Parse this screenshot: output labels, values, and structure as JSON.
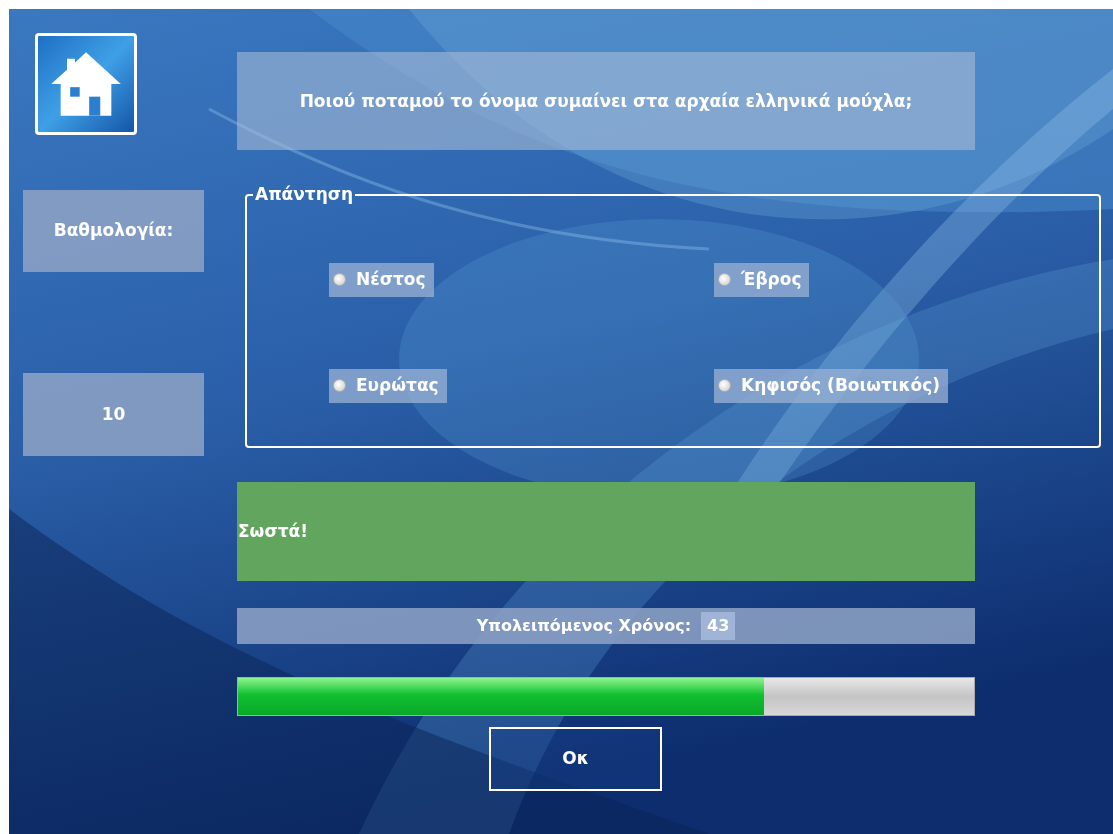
{
  "question": "Ποιού ποταμού το όνομα συμαίνει στα αρχαία ελληνικά μούχλα;",
  "score": {
    "label": "Βαθμολογία:",
    "value": "10"
  },
  "answer": {
    "legend": "Απάντηση",
    "options": [
      {
        "label": "Νέστος",
        "selected": false
      },
      {
        "label": "Έβρος",
        "selected": false
      },
      {
        "label": "Ευρώτας",
        "selected": false
      },
      {
        "label": "Κηφισός (Βοιωτικός)",
        "selected": false
      }
    ]
  },
  "feedback": {
    "text": "Σωστά!",
    "kind": "correct"
  },
  "timer": {
    "label": "Υπολειπόμενος Χρόνος:",
    "value": "43"
  },
  "progress": {
    "level": 0.715
  },
  "ok_button": "Οκ"
}
